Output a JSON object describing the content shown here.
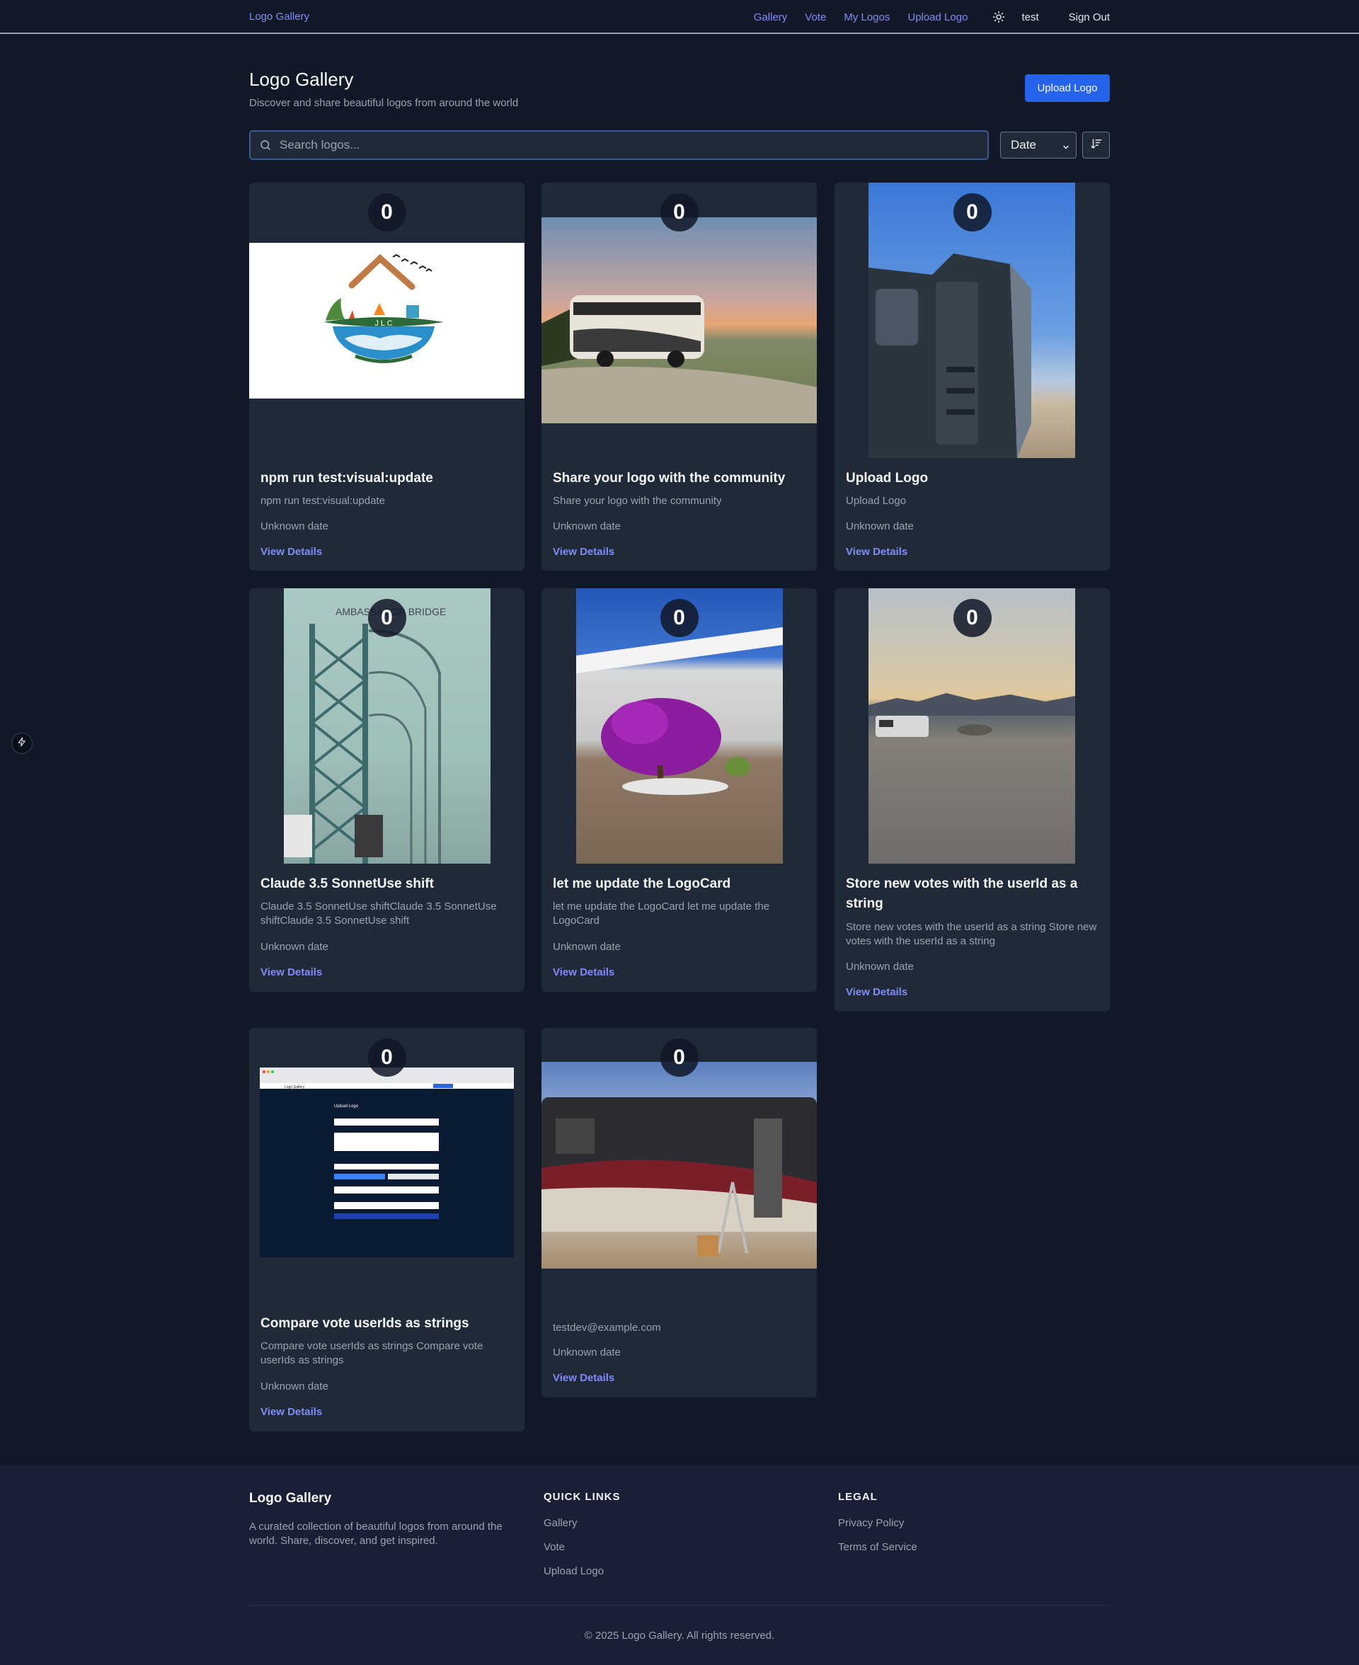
{
  "nav": {
    "brand": "Logo Gallery",
    "links": [
      "Gallery",
      "Vote",
      "My Logos",
      "Upload Logo"
    ],
    "user": "test",
    "signout": "Sign Out"
  },
  "header": {
    "title": "Logo Gallery",
    "subtitle": "Discover and share beautiful logos from around the world",
    "upload_button": "Upload Logo"
  },
  "search": {
    "placeholder": "Search logos..."
  },
  "sort": {
    "selected": "Date"
  },
  "cards": [
    {
      "votes": "0",
      "title": "npm run test:visual:update",
      "description": "npm run test:visual:update",
      "date": "Unknown date",
      "details": "View Details"
    },
    {
      "votes": "0",
      "title": "Share your logo with the community",
      "description": "Share your logo with the community",
      "date": "Unknown date",
      "details": "View Details"
    },
    {
      "votes": "0",
      "title": "Upload Logo",
      "description": "Upload Logo",
      "date": "Unknown date",
      "details": "View Details"
    },
    {
      "votes": "0",
      "title": "Claude 3.5 SonnetUse shift",
      "description": "Claude 3.5 SonnetUse shiftClaude 3.5 SonnetUse shiftClaude 3.5 SonnetUse shift",
      "date": "Unknown date",
      "details": "View Details"
    },
    {
      "votes": "0",
      "title": "let me update the LogoCard",
      "description": "let me update the LogoCard let me update the LogoCard",
      "date": "Unknown date",
      "details": "View Details"
    },
    {
      "votes": "0",
      "title": "Store new votes with the userId as a string",
      "description": "Store new votes with the userId as a string Store new votes with the userId as a string",
      "date": "Unknown date",
      "details": "View Details"
    },
    {
      "votes": "0",
      "title": "Compare vote userIds as strings",
      "description": "Compare vote userIds as strings Compare vote userIds as strings",
      "date": "Unknown date",
      "details": "View Details"
    },
    {
      "votes": "0",
      "title": "",
      "description": "testdev@example.com",
      "date": "Unknown date",
      "details": "View Details"
    }
  ],
  "logo_text": "J L C",
  "bridge_sign": "AMBASSADOR BRIDGE",
  "screenshot_card": {
    "heading": "Upload Logo",
    "brand": "Logo Gallery"
  },
  "footer": {
    "title": "Logo Gallery",
    "description": "A curated collection of beautiful logos from around the world. Share, discover, and get inspired.",
    "quick_links_heading": "QUICK LINKS",
    "quick_links": [
      "Gallery",
      "Vote",
      "Upload Logo"
    ],
    "legal_heading": "LEGAL",
    "legal_links": [
      "Privacy Policy",
      "Terms of Service"
    ],
    "copyright": "© 2025 Logo Gallery. All rights reserved."
  },
  "colors": {
    "background": "#111827",
    "card": "#1f2937",
    "accent": "#818cf8",
    "primary_button": "#2563eb"
  }
}
